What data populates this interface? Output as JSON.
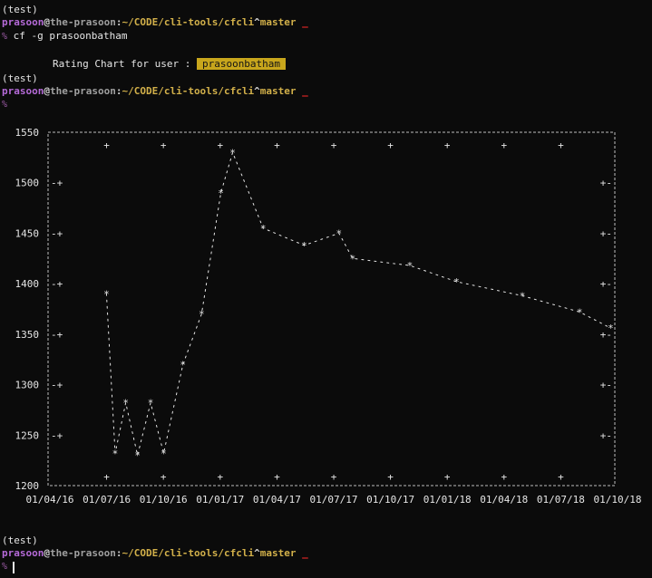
{
  "terminal": {
    "venv": "(test)",
    "prompt": {
      "user": "prasoon",
      "at": "@",
      "host": "the-prasoon",
      "colon": ":",
      "path": "~/CODE/cli-tools/cfcli",
      "caret": "^",
      "branch": "master",
      "cursor_mark": "_"
    },
    "prompt_mark": "%",
    "command": "cf -g prasoonbatham",
    "rating_label": "Rating Chart for user :",
    "username_badge": "prasoonbatham"
  },
  "chart_data": {
    "type": "line",
    "title": "Rating Chart for user : prasoonbatham",
    "xlabel": "",
    "ylabel": "",
    "ylim": [
      1200,
      1550
    ],
    "y_ticks": [
      "1550",
      "1500",
      "1450",
      "1400",
      "1350",
      "1300",
      "1250",
      "1200"
    ],
    "x_ticks": [
      "01/04/16",
      "01/07/16",
      "01/10/16",
      "01/01/17",
      "01/04/17",
      "01/07/17",
      "01/10/17",
      "01/01/18",
      "01/04/18",
      "01/07/18",
      "01/10/18"
    ],
    "points": [
      {
        "x": "2016-07-01",
        "y": 1390
      },
      {
        "x": "2016-07-15",
        "y": 1232
      },
      {
        "x": "2016-08-01",
        "y": 1282
      },
      {
        "x": "2016-08-20",
        "y": 1230
      },
      {
        "x": "2016-09-10",
        "y": 1282
      },
      {
        "x": "2016-10-01",
        "y": 1232
      },
      {
        "x": "2016-11-01",
        "y": 1320
      },
      {
        "x": "2016-12-01",
        "y": 1370
      },
      {
        "x": "2017-01-01",
        "y": 1490
      },
      {
        "x": "2017-01-20",
        "y": 1530
      },
      {
        "x": "2017-03-10",
        "y": 1455
      },
      {
        "x": "2017-05-15",
        "y": 1438
      },
      {
        "x": "2017-07-10",
        "y": 1450
      },
      {
        "x": "2017-08-01",
        "y": 1425
      },
      {
        "x": "2017-11-01",
        "y": 1418
      },
      {
        "x": "2018-01-15",
        "y": 1402
      },
      {
        "x": "2018-05-01",
        "y": 1388
      },
      {
        "x": "2018-08-01",
        "y": 1372
      },
      {
        "x": "2018-09-20",
        "y": 1356
      }
    ]
  }
}
